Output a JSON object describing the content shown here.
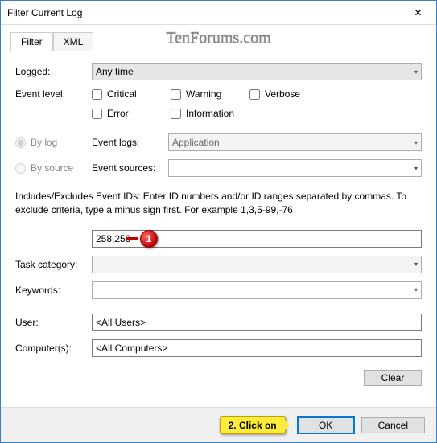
{
  "window": {
    "title": "Filter Current Log"
  },
  "watermark": "TenForums.com",
  "tabs": {
    "filter": "Filter",
    "xml": "XML"
  },
  "labels": {
    "logged": "Logged:",
    "event_level": "Event level:",
    "by_log": "By log",
    "by_source": "By source",
    "event_logs": "Event logs:",
    "event_sources": "Event sources:",
    "task_category": "Task category:",
    "keywords": "Keywords:",
    "user": "User:",
    "computers": "Computer(s):"
  },
  "logged_value": "Any time",
  "levels": {
    "critical": "Critical",
    "warning": "Warning",
    "verbose": "Verbose",
    "error": "Error",
    "information": "Information"
  },
  "event_logs_value": "Application",
  "event_sources_value": "",
  "help_text": "Includes/Excludes Event IDs: Enter ID numbers and/or ID ranges separated by commas. To exclude criteria, type a minus sign first. For example 1,3,5-99,-76",
  "event_ids_value": "258,259",
  "task_category_value": "",
  "keywords_value": "",
  "user_value": "<All Users>",
  "computers_value": "<All Computers>",
  "buttons": {
    "clear": "Clear",
    "ok": "OK",
    "cancel": "Cancel"
  },
  "annotations": {
    "m1": "1",
    "m2": "2. Click on"
  }
}
